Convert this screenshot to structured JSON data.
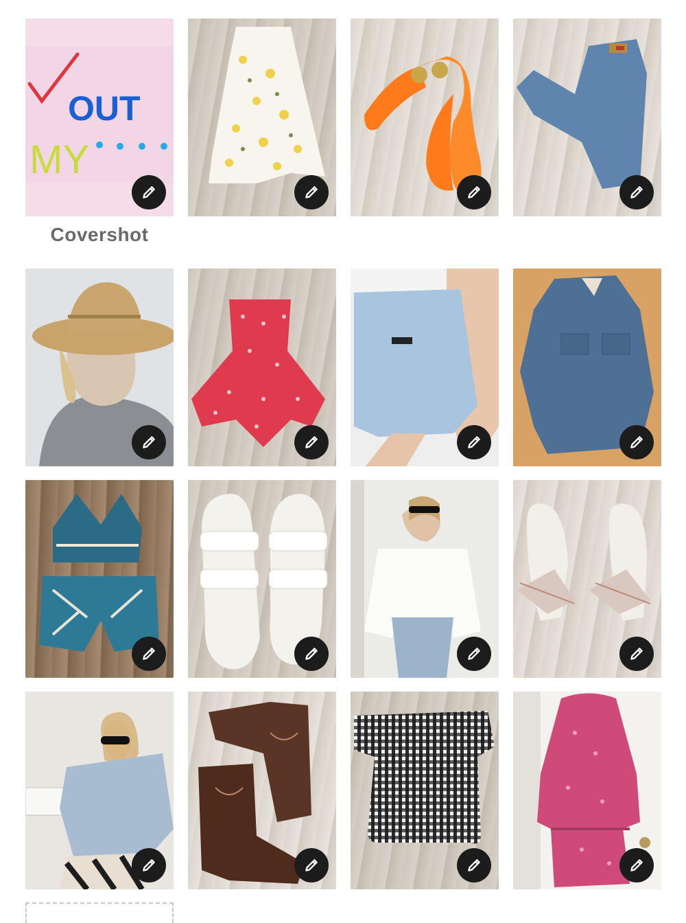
{
  "cover": {
    "label": "Covershot",
    "art_text_line1": "OUT",
    "art_text_line2": "MY....",
    "colors": {
      "check": "#e0353c",
      "out": "#1a5fd6",
      "my": "#c7dc3a",
      "dots": "#2aa8e8",
      "bg": "#f6dbe9"
    }
  },
  "tiles": [
    {
      "name": "tile-floral-skirt",
      "edit_icon": "pencil-icon"
    },
    {
      "name": "tile-orange-sandals",
      "edit_icon": "pencil-icon"
    },
    {
      "name": "tile-jeans",
      "edit_icon": "pencil-icon"
    },
    {
      "name": "tile-straw-hat-selfie",
      "edit_icon": "pencil-icon"
    },
    {
      "name": "tile-red-romper",
      "edit_icon": "pencil-icon"
    },
    {
      "name": "tile-denim-shorts",
      "edit_icon": "pencil-icon"
    },
    {
      "name": "tile-denim-shirt",
      "edit_icon": "pencil-icon"
    },
    {
      "name": "tile-crochet-set",
      "edit_icon": "pencil-icon"
    },
    {
      "name": "tile-white-slides",
      "edit_icon": "pencil-icon"
    },
    {
      "name": "tile-white-tie-top",
      "edit_icon": "pencil-icon"
    },
    {
      "name": "tile-bow-heels",
      "edit_icon": "pencil-icon"
    },
    {
      "name": "tile-denim-jacket-selfie",
      "edit_icon": "pencil-icon"
    },
    {
      "name": "tile-cowboy-boots",
      "edit_icon": "pencil-icon"
    },
    {
      "name": "tile-gingham-top",
      "edit_icon": "pencil-icon"
    },
    {
      "name": "tile-pink-dress",
      "edit_icon": "pencil-icon"
    }
  ],
  "add_photo_slot": {
    "icon": "dashed-placeholder"
  }
}
